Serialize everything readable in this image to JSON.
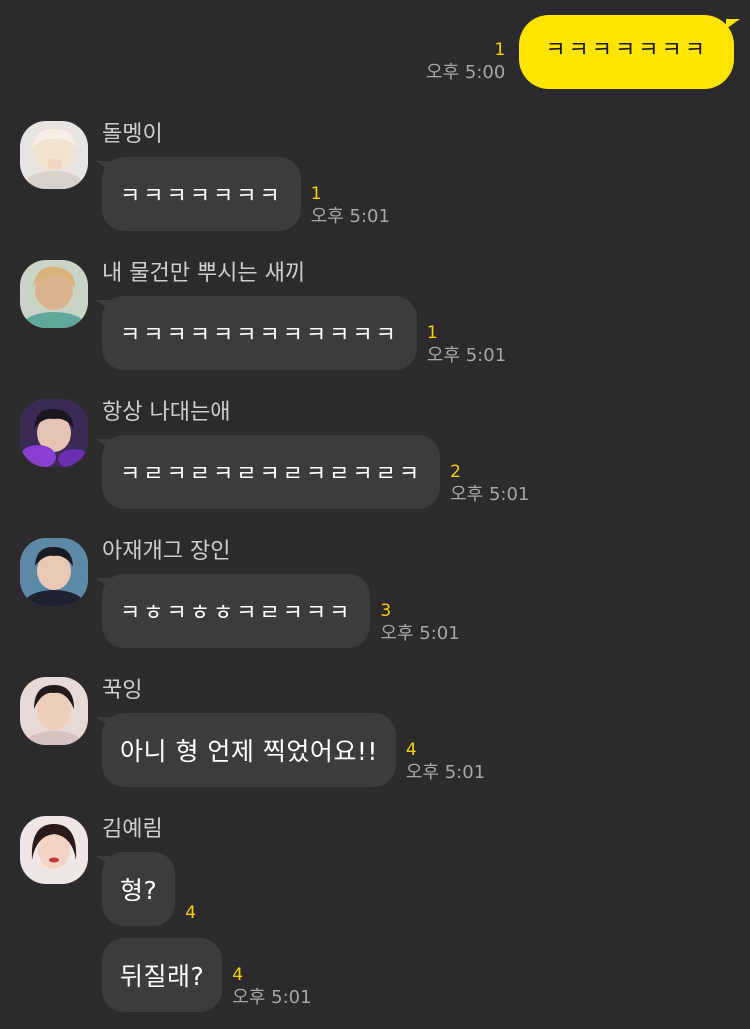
{
  "outgoing": {
    "text": "ㅋㅋㅋㅋㅋㅋㅋ",
    "unread": "1",
    "time": "오후 5:00"
  },
  "messages": [
    {
      "sender": "돌멩이",
      "avatar_icon": "profile-photo-icon",
      "bubbles": [
        {
          "text": "ㅋㅋㅋㅋㅋㅋㅋ",
          "unread": "1",
          "time": "오후 5:01"
        }
      ]
    },
    {
      "sender": "내 물건만 뿌시는 새끼",
      "avatar_icon": "profile-photo-icon",
      "bubbles": [
        {
          "text": "ㅋㅋㅋㅋㅋㅋㅋㅋㅋㅋㅋㅋ",
          "unread": "1",
          "time": "오후 5:01"
        }
      ]
    },
    {
      "sender": "항상 나대는애",
      "avatar_icon": "profile-photo-icon",
      "bubbles": [
        {
          "text": "ㅋㄹㅋㄹㅋㄹㅋㄹㅋㄹㅋㄹㅋ",
          "unread": "2",
          "time": "오후 5:01"
        }
      ]
    },
    {
      "sender": "아재개그 장인",
      "avatar_icon": "profile-photo-icon",
      "bubbles": [
        {
          "text": "ㅋㅎㅋㅎㅎㅋㄹㅋㅋㅋ",
          "unread": "3",
          "time": "오후 5:01"
        }
      ]
    },
    {
      "sender": "꾹잉",
      "avatar_icon": "profile-photo-icon",
      "bubbles": [
        {
          "text": "아니 형 언제 찍었어요!!",
          "unread": "4",
          "time": "오후 5:01"
        }
      ]
    },
    {
      "sender": "김예림",
      "avatar_icon": "profile-photo-icon",
      "bubbles": [
        {
          "text": "형?",
          "unread": "4",
          "time": ""
        },
        {
          "text": "뒤질래?",
          "unread": "4",
          "time": "오후 5:01"
        }
      ]
    }
  ],
  "colors": {
    "background": "#2b2b2d",
    "outgoing_bubble": "#fee500",
    "incoming_bubble": "#3c3c3e",
    "unread_count": "#f5d300",
    "timestamp": "#a7a7a7",
    "sender_name": "#cfcfcf"
  }
}
